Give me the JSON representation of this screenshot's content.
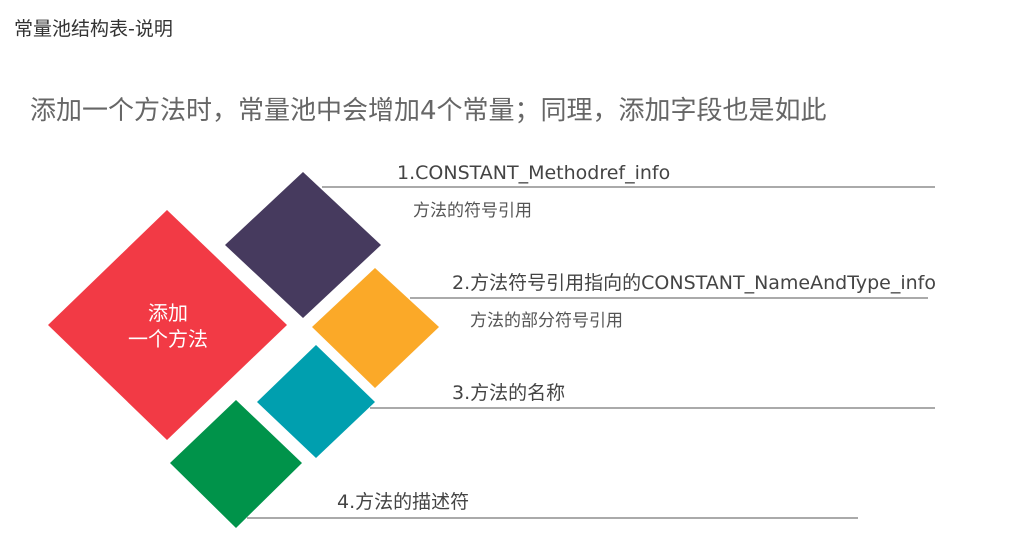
{
  "slide": {
    "title": "常量池结构表-说明",
    "subtitle": "添加一个方法时，常量池中会增加4个常量；同理，添加字段也是如此",
    "center": {
      "line1": "添加",
      "line2": "一个方法",
      "color": "#f23a45"
    },
    "items": [
      {
        "label": "1.CONSTANT_Methodref_info",
        "desc": "方法的符号引用",
        "color": "#463a5e"
      },
      {
        "label": "2.方法符号引用指向的CONSTANT_NameAndType_info",
        "desc": "方法的部分符号引用",
        "color": "#fba928"
      },
      {
        "label": "3.方法的名称",
        "color": "#009faf"
      },
      {
        "label": "4.方法的描述符",
        "color": "#00934a"
      }
    ]
  }
}
